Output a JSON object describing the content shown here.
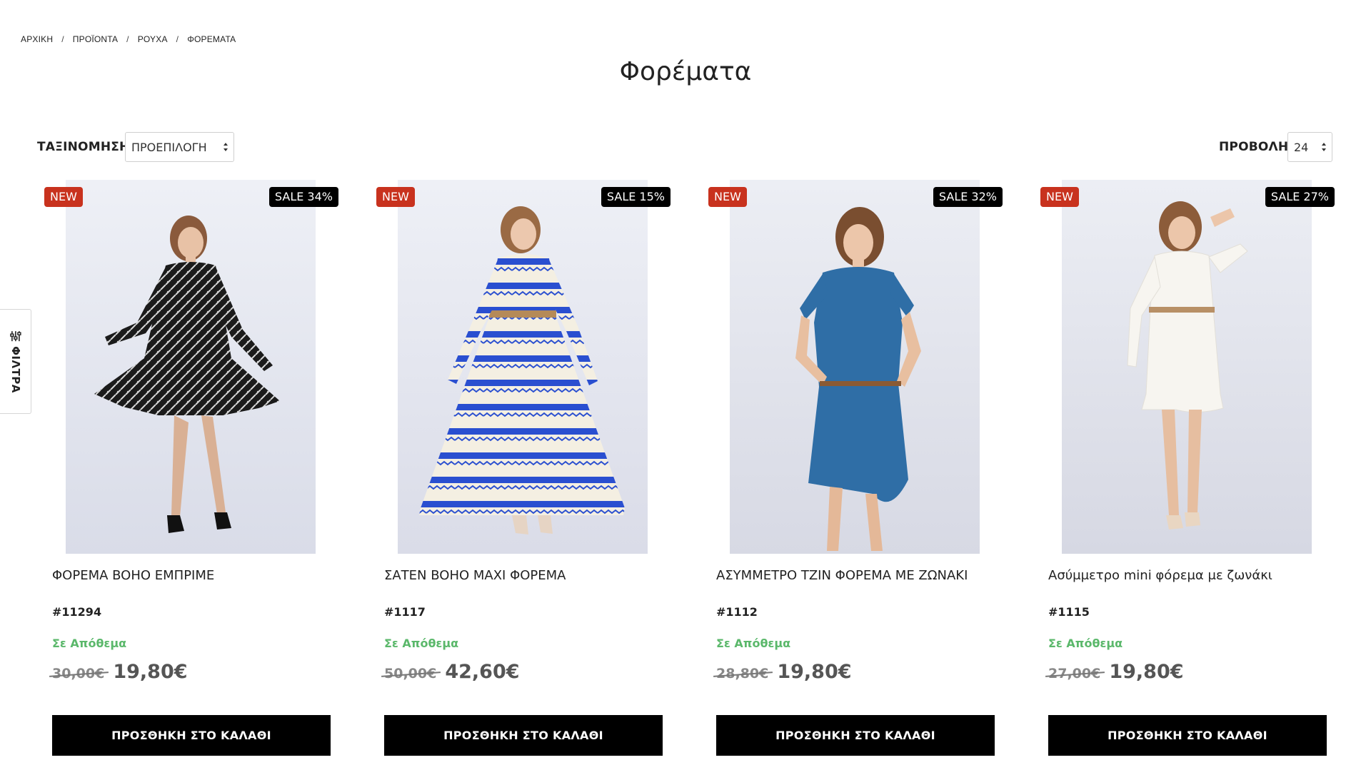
{
  "breadcrumb": [
    "ΑΡΧΙΚΗ",
    "ΠΡΟΪΟΝΤΑ",
    "ΡΟΥΧΑ",
    "ΦΟΡΕΜΑΤΑ"
  ],
  "breadcrumb_separator": "/",
  "page_title": "Φορέματα",
  "sort": {
    "label": "ΤΑΞΙΝΟΜΗΣΗ",
    "selected": "ΠΡΟΕΠΙΛΟΓΗ"
  },
  "view": {
    "label": "ΠΡΟΒΟΛΗ",
    "selected": "24"
  },
  "filters_tab": {
    "label": "ΦΙΛΤΡΑ",
    "icon": "sliders-icon"
  },
  "colors": {
    "new_badge": "#c8321e",
    "sale_badge": "#000000",
    "in_stock": "#5bb86b",
    "cart_button": "#000000"
  },
  "products": [
    {
      "name": "ΦΟΡΕΜΑ BOHO ΕΜΠΡΙΜΕ",
      "sku": "#11294",
      "new_badge": "NEW",
      "sale_badge": "SALE 34%",
      "stock": "Σε Απόθεμα",
      "old_price": "30,00€",
      "price": "19,80€",
      "button": "ΠΡΟΣΘΗΚΗ ΣΤΟ ΚΑΛΑΘΙ",
      "image": "model in black-and-white print dress"
    },
    {
      "name": "ΣΑΤΕΝ BOHO ΜΑΧΙ ΦΟΡΕΜΑ",
      "sku": "#1117",
      "new_badge": "NEW",
      "sale_badge": "SALE 15%",
      "stock": "Σε Απόθεμα",
      "old_price": "50,00€",
      "price": "42,60€",
      "button": "ΠΡΟΣΘΗΚΗ ΣΤΟ ΚΑΛΑΘΙ",
      "image": "model in white maxi dress with blue pattern"
    },
    {
      "name": "ΑΣΥΜΜΕΤΡΟ ΤΖΙΝ ΦΟΡΕΜΑ ΜΕ ΖΩΝΑΚΙ",
      "sku": "#1112",
      "new_badge": "NEW",
      "sale_badge": "SALE 32%",
      "stock": "Σε Απόθεμα",
      "old_price": "28,80€",
      "price": "19,80€",
      "button": "ΠΡΟΣΘΗΚΗ ΣΤΟ ΚΑΛΑΘΙ",
      "image": "model in denim shirt dress with belt"
    },
    {
      "name": "Ασύμμετρο mini φόρεμα με ζωνάκι",
      "sku": "#1115",
      "new_badge": "NEW",
      "sale_badge": "SALE 27%",
      "stock": "Σε Απόθεμα",
      "old_price": "27,00€",
      "price": "19,80€",
      "button": "ΠΡΟΣΘΗΚΗ ΣΤΟ ΚΑΛΑΘΙ",
      "image": "model in white mini dress with belt"
    }
  ]
}
